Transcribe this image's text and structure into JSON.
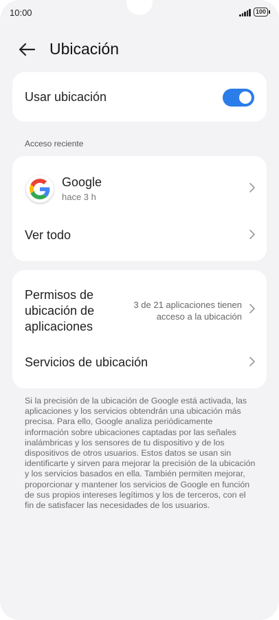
{
  "status_bar": {
    "time": "10:00",
    "battery": "100"
  },
  "header": {
    "title": "Ubicación"
  },
  "location_toggle": {
    "label": "Usar ubicación",
    "enabled": true,
    "accent_color": "#2b7de9"
  },
  "recent_access": {
    "section_label": "Acceso reciente",
    "apps": [
      {
        "name": "Google",
        "subtitle": "hace 3 h",
        "icon": "google-icon"
      }
    ],
    "see_all_label": "Ver todo"
  },
  "permissions": {
    "title": "Permisos de ubicación de aplicaciones",
    "value": "3 de 21 aplicaciones tienen acceso a la ubicación"
  },
  "location_services": {
    "label": "Servicios de ubicación"
  },
  "footer": {
    "text": "Si la precisión de la ubicación de Google está activada, las aplicaciones y los servicios obtendrán una ubicación más precisa. Para ello, Google analiza periódicamente información sobre ubicaciones captadas por las señales inalámbricas y los sensores de tu dispositivo y de los dispositivos de otros usuarios. Estos datos se usan sin identificarte y sirven para mejorar la precisión de la ubicación y los servicios basados en ella. También permiten mejorar, proporcionar y mantener los servicios de Google en función de sus propios intereses legítimos y los de terceros, con el fin de satisfacer las necesidades de los usuarios."
  }
}
